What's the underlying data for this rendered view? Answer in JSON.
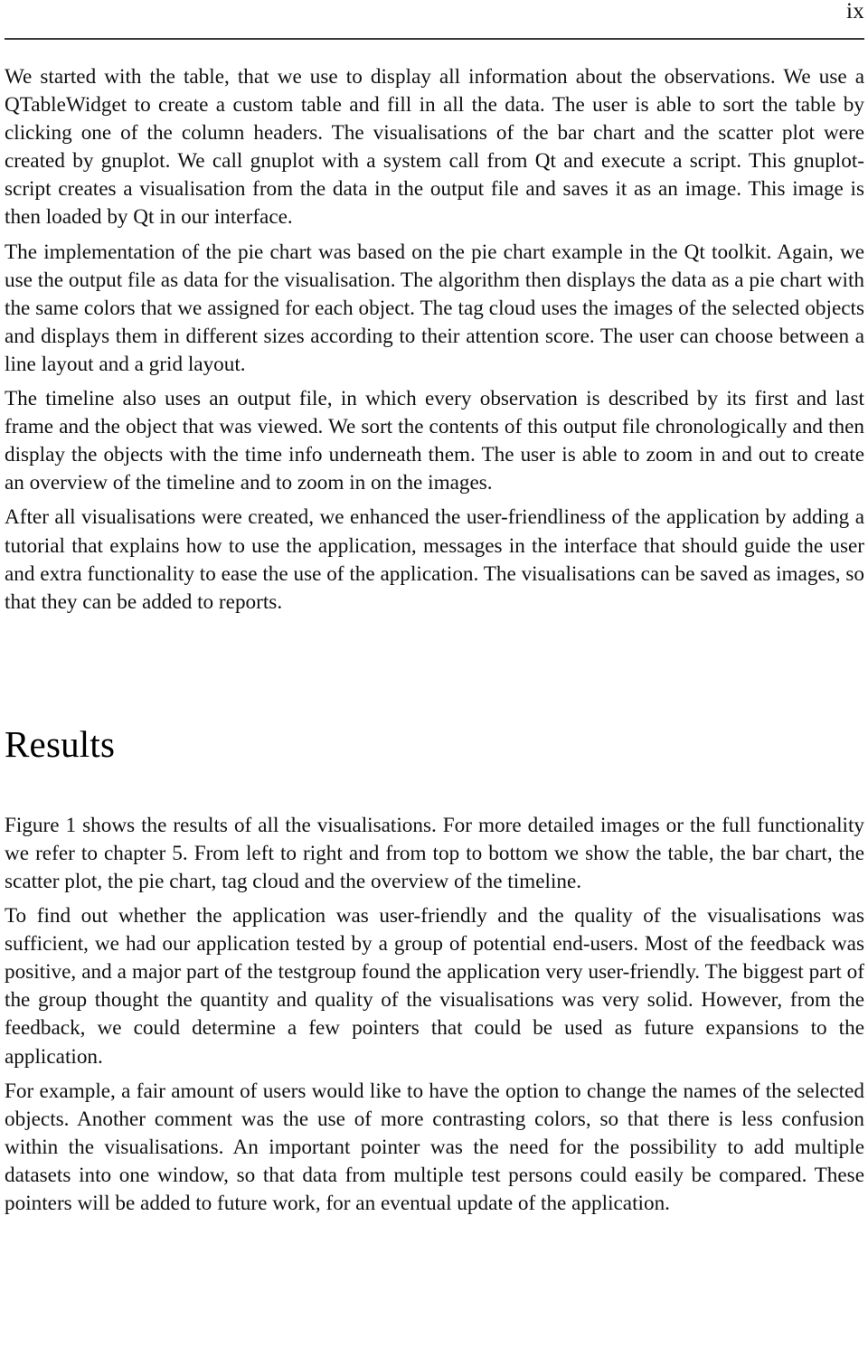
{
  "header": {
    "folio": "ix"
  },
  "body": {
    "paragraphs": [
      "We started with the table, that we use to display all information about the observations. We use a QTableWidget to create a custom table and fill in all the data. The user is able to sort the table by clicking one of the column headers. The visualisations of the bar chart and the scatter plot were created by gnuplot. We call gnuplot with a system call from Qt and execute a script. This gnuplot-script creates a visualisation from the data in the output file and saves it as an image. This image is then loaded by Qt in our interface.",
      "The implementation of the pie chart was based on the pie chart example in the Qt toolkit. Again, we use the output file as data for the visualisation. The algorithm then displays the data as a pie chart with the same colors that we assigned for each object. The tag cloud uses the images of the selected objects and displays them in different sizes according to their attention score. The user can choose between a line layout and a grid layout.",
      "The timeline also uses an output file, in which every observation is described by its first and last frame and the object that was viewed. We sort the contents of this output file chronologically and then display the objects with the time info underneath them. The user is able to zoom in and out to create an overview of the timeline and to zoom in on the images.",
      "After all visualisations were created, we enhanced the user-friendliness of the application by adding a tutorial that explains how to use the application, messages in the interface that should guide the user and extra functionality to ease the use of the application. The visualisations can be saved as images, so that they can be added to reports."
    ]
  },
  "results_section": {
    "title": "Results",
    "paragraphs": [
      "Figure 1 shows the results of all the visualisations. For more detailed images or the full functionality we refer to chapter 5. From left to right and from top to bottom we show the table, the bar chart, the scatter plot, the pie chart, tag cloud and the overview of the timeline.",
      "To find out whether the application was user-friendly and the quality of the visualisations was sufficient, we had our application tested by a group of potential end-users. Most of the feedback was positive, and a major part of the testgroup found the application very user-friendly. The biggest part of the group thought the quantity and quality of the visualisations was very solid. However, from the feedback, we could determine a few pointers that could be used as future expansions to the application.",
      "For example, a fair amount of users would like to have the option to change the names of the selected objects. Another comment was the use of more contrasting colors, so that there is less confusion within the visualisations. An important pointer was the need for the possibility to add multiple datasets into one window, so that data from multiple test persons could easily be compared. These pointers will be added to future work, for an eventual update of the application."
    ]
  }
}
